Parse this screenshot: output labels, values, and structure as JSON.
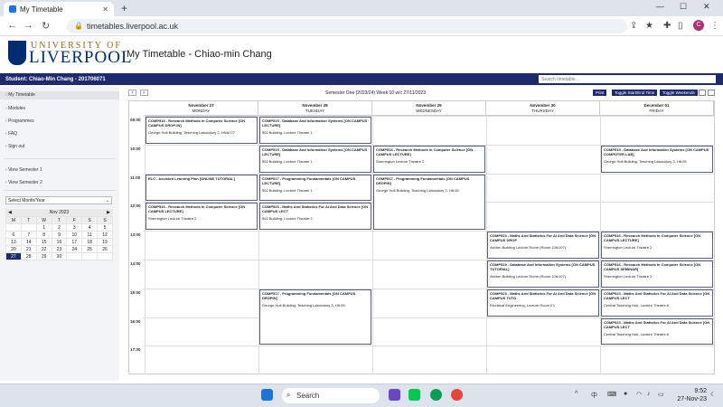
{
  "browser": {
    "tab_title": "My Timetable",
    "url": "timetables.liverpool.ac.uk",
    "new_tab": "+",
    "minimize": "—",
    "restore": "☐",
    "close": "✕",
    "avatar": "C"
  },
  "header": {
    "uni_top": "UNIVERSITY OF",
    "uni_bottom": "LIVERPOOL",
    "page_title": "My Timetable - Chiao-min Chang"
  },
  "student_bar": {
    "label": "Student: Chiao-Min Chang - 201706071",
    "search_placeholder": "Search timetable..."
  },
  "sidebar": {
    "items": [
      "My Timetable",
      "Modules",
      "Programmes",
      "FAQ",
      "Sign out",
      "View Semester 1",
      "View Semester 2"
    ],
    "month_select": "Select Month/Year",
    "calendar": {
      "month": "Nov 2023",
      "prev": "◀",
      "next": "▶",
      "weekdays": [
        "M",
        "T",
        "W",
        "T",
        "F",
        "S",
        "S"
      ],
      "weeks": [
        [
          "",
          "",
          "1",
          "2",
          "3",
          "4",
          "5"
        ],
        [
          "6",
          "7",
          "8",
          "9",
          "10",
          "11",
          "12"
        ],
        [
          "13",
          "14",
          "15",
          "16",
          "17",
          "18",
          "19"
        ],
        [
          "20",
          "21",
          "22",
          "23",
          "24",
          "25",
          "26"
        ],
        [
          "27",
          "28",
          "29",
          "30",
          "",
          "",
          ""
        ]
      ],
      "selected": "27"
    }
  },
  "toolbar": {
    "prev": "‹",
    "next": "›",
    "semester_text": "Semester One (2023/24) Week 10 w/c 27/11/2023",
    "print": "Print",
    "toggle_time": "Toggle Start/End Time",
    "toggle_weekends": "Toggle Weekends"
  },
  "days": [
    {
      "date": "November 27",
      "name": "MONDAY"
    },
    {
      "date": "November 28",
      "name": "TUESDAY"
    },
    {
      "date": "November 29",
      "name": "WEDNESDAY"
    },
    {
      "date": "November 30",
      "name": "THURSDAY"
    },
    {
      "date": "December 01",
      "name": "FRIDAY"
    }
  ],
  "times": [
    "09:00",
    "10:00",
    "11:00",
    "12:00",
    "13:00",
    "14:00",
    "15:00",
    "16:00",
    "17:00"
  ],
  "events": [
    {
      "title": "COMP516 - Research Methods In Computer Science [ON CAMPUS DROP-IN]",
      "location": "George Holt Building, Teaching Laboratory 2, H5/6/7/7"
    },
    {
      "title": "COMP519 - Database And Information Systems [ON CAMPUS LECTURE]",
      "location": "502 Building, Lecture Theatre 1"
    },
    {
      "title": "COMP519 - Database And Information Systems [ON CAMPUS LECTURE]",
      "location": "502 Building, Lecture Theatre 1"
    },
    {
      "title": "COMP516 - Research Methods In Computer Science [ON CAMPUS LECTURE]",
      "location": "Sherrington Lecture Theatre 2"
    },
    {
      "title": "COMP519 - Database And Information Systems [ON CAMPUS COMPUTER LAB]",
      "location": "George Holt Building, Teaching Laboratory 3, H8.05"
    },
    {
      "title": "ELC - Assisted Learning Plan [ONLINE TUTORIAL]",
      "location": ""
    },
    {
      "title": "COMP517 - Programming Fundamentals [ON CAMPUS LECTURE]",
      "location": "502 Building, Lecture Theatre 1"
    },
    {
      "title": "COMP517 - Programming Fundamentals [ON CAMPUS DROPIN]",
      "location": "George Holt Building, Teaching Laboratory 3, H8.05"
    },
    {
      "title": "COMP516 - Research Methods In Computer Science [ON CAMPUS LECTURE]",
      "location": "Sherrington Lecture Theatre 2"
    },
    {
      "title": "COMP523 - Maths And Statistics For AI And Data Science [ON CAMPUS LECT",
      "location": "502 Building, Lecture Theatre 2"
    },
    {
      "title": "COMP523 - Maths And Statistics For AI And Data Science [ON CAMPUS DROP",
      "location": "Ashton Building Lecture Room (Room 106/107)"
    },
    {
      "title": "COMP516 - Research Methods In Computer Science [ON CAMPUS LECTURE]",
      "location": "Sherrington Lecture Theatre 2"
    },
    {
      "title": "COMP519 - Database And Information Systems [ON CAMPUS TUTORIAL]",
      "location": "Ashton Building Lecture Room (Room 106/107)"
    },
    {
      "title": "COMP516 - Research Methods In Computer Science [ON CAMPUS SEMINAR]",
      "location": "Sherrington Lecture Theatre 2"
    },
    {
      "title": "COMP517 - Programming Fundamentals [ON CAMPUS DROPIN]",
      "location": "George Holt Building, Teaching Laboratory 3, H8.05"
    },
    {
      "title": "COMP523 - Maths And Statistics For AI And Data Science [ON CAMPUS TUTO",
      "location": "Electrical Engineering, Lecture Room E1"
    },
    {
      "title": "COMP523 - Maths And Statistics For AI And Data Science [ON CAMPUS LECT",
      "location": "Central Teaching Hub, Lecture Theatre A"
    },
    {
      "title": "COMP523 - Maths And Statistics For AI And Data Science [ON CAMPUS LECT",
      "location": "Central Teaching Hub, Lecture Theatre A"
    }
  ],
  "taskbar": {
    "search": "Search",
    "time": "9:52",
    "date": "27-Nov-23",
    "lang": "中",
    "tray_up": "^"
  },
  "colors": {
    "brand": "#1f2a6e",
    "logo_blue": "#002d72",
    "logo_gold": "#8c6d1f"
  }
}
